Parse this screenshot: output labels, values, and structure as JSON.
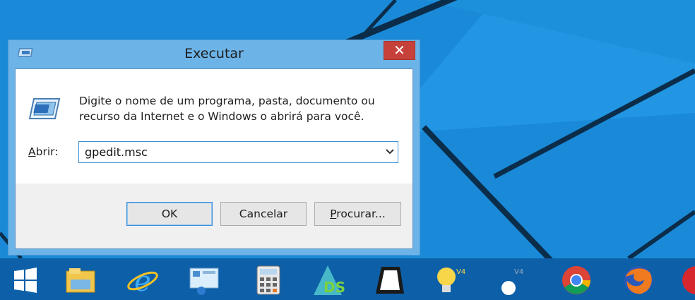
{
  "dialog": {
    "title": "Executar",
    "close_glyph": "✕",
    "instruction_line1": "Digite o nome de um programa, pasta, documento ou",
    "instruction_line2": "recurso da Internet e o Windows o abrirá para você.",
    "open_label_accel": "A",
    "open_label_rest": "brir:",
    "open_value": "gpedit.msc",
    "ok_label": "OK",
    "cancel_label": "Cancelar",
    "browse_label_accel": "P",
    "browse_label_rest": "rocurar..."
  },
  "taskbar": {
    "items": [
      "start-icon",
      "file-explorer-icon",
      "internet-explorer-icon",
      "control-panel-icon",
      "calculator-icon",
      "ds-app-icon",
      "photo-app-icon",
      "lightbulb-app-icon",
      "dot-app-icon",
      "chrome-icon",
      "firefox-icon",
      "opera-icon"
    ]
  },
  "colors": {
    "desktop": "#1a8ad8",
    "title_bar": "#6cb4e8",
    "close_button": "#c7413b",
    "taskbar": "#0d5fa8"
  }
}
